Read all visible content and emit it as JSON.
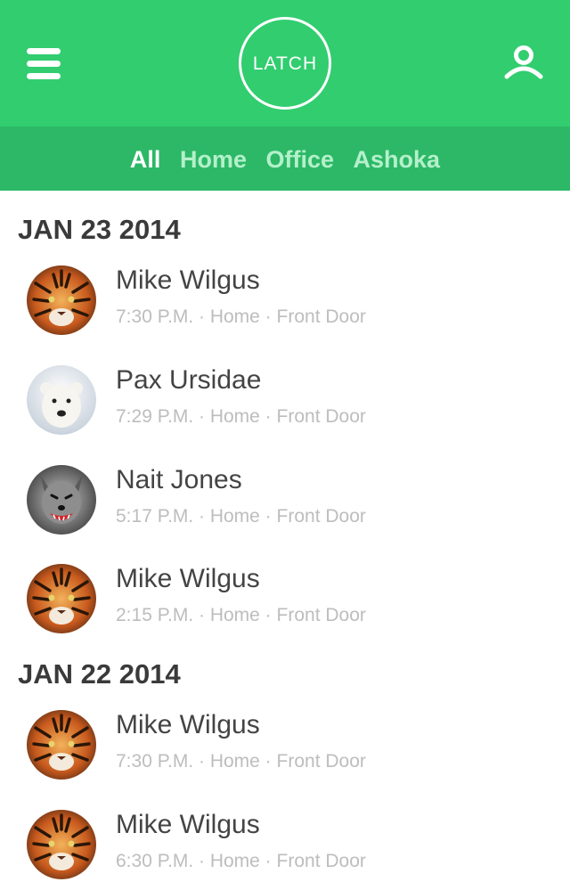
{
  "header": {
    "logo_text": "LATCH"
  },
  "tabs": [
    {
      "label": "All",
      "active": true
    },
    {
      "label": "Home",
      "active": false
    },
    {
      "label": "Office",
      "active": false
    },
    {
      "label": "Ashoka",
      "active": false
    }
  ],
  "groups": [
    {
      "date": "JAN 23 2014",
      "entries": [
        {
          "name": "Mike Wilgus",
          "meta": "7:30 P.M. · Home · Front Door",
          "avatar": "tiger-avatar-icon"
        },
        {
          "name": "Pax Ursidae",
          "meta": "7:29 P.M. · Home · Front Door",
          "avatar": "polar-bear-avatar-icon"
        },
        {
          "name": "Nait Jones",
          "meta": "5:17 P.M. · Home · Front Door",
          "avatar": "wolf-avatar-icon"
        },
        {
          "name": "Mike Wilgus",
          "meta": "2:15 P.M. · Home · Front Door",
          "avatar": "tiger-avatar-icon"
        }
      ]
    },
    {
      "date": "JAN 22 2014",
      "entries": [
        {
          "name": "Mike Wilgus",
          "meta": "7:30 P.M. · Home · Front Door",
          "avatar": "tiger-avatar-icon"
        },
        {
          "name": "Mike Wilgus",
          "meta": "6:30 P.M. · Home · Front Door",
          "avatar": "tiger-avatar-icon"
        }
      ]
    }
  ],
  "colors": {
    "header_green": "#31cd6f",
    "tabs_green": "#2cb866",
    "tab_inactive": "#b4f0cb",
    "name_text": "#444444",
    "meta_text": "#bdbdbd"
  }
}
